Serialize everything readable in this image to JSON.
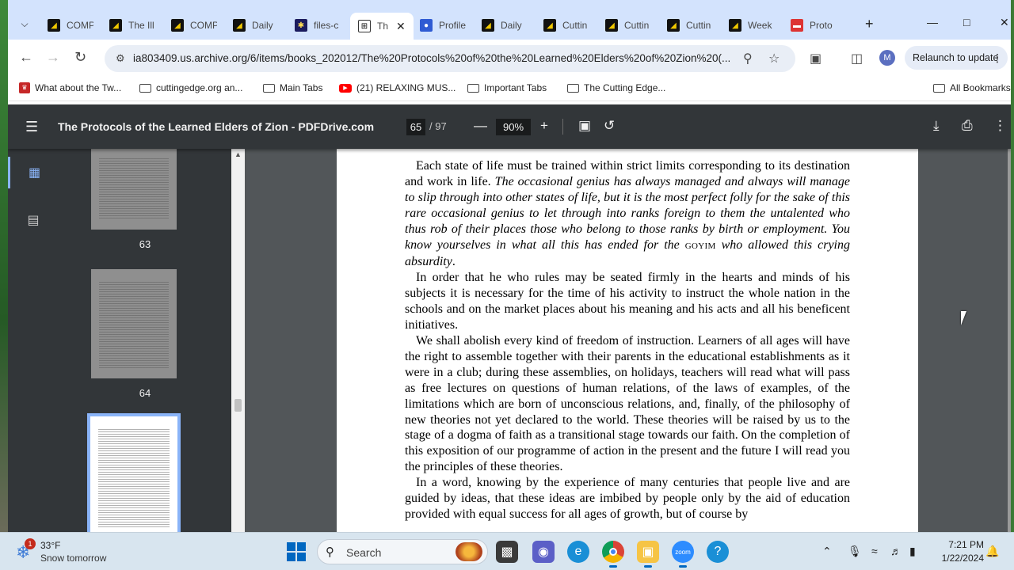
{
  "browser": {
    "tabs": [
      {
        "label": "COMP",
        "favicon": "cutting-edge"
      },
      {
        "label": "The Ill",
        "favicon": "cutting-edge"
      },
      {
        "label": "COMP",
        "favicon": "cutting-edge"
      },
      {
        "label": "Daily",
        "favicon": "cutting-edge"
      },
      {
        "label": "files-c",
        "favicon": "star"
      },
      {
        "label": "Th",
        "favicon": "internet-archive",
        "active": true
      },
      {
        "label": "Profile",
        "favicon": "profile"
      },
      {
        "label": "Daily",
        "favicon": "cutting-edge"
      },
      {
        "label": "Cuttin",
        "favicon": "cutting-edge"
      },
      {
        "label": "Cuttin",
        "favicon": "cutting-edge"
      },
      {
        "label": "Cuttin",
        "favicon": "cutting-edge"
      },
      {
        "label": "Week",
        "favicon": "cutting-edge"
      },
      {
        "label": "Proto",
        "favicon": "protocols"
      }
    ],
    "url": "ia803409.us.archive.org/6/items/books_202012/The%20Protocols%20of%20the%20Learned%20Elders%20of%20Zion%20(...",
    "profile_initial": "M",
    "relaunch_label": "Relaunch to update",
    "bookmarks": [
      {
        "label": "What about the Tw...",
        "icon": "site-icon"
      },
      {
        "label": "cuttingedge.org an...",
        "icon": "folder-icon"
      },
      {
        "label": "Main Tabs",
        "icon": "folder-icon"
      },
      {
        "label": "(21) RELAXING MUS...",
        "icon": "youtube-icon"
      },
      {
        "label": "Important Tabs",
        "icon": "folder-icon"
      },
      {
        "label": "The Cutting Edge...",
        "icon": "folder-icon"
      }
    ],
    "all_bookmarks_label": "All Bookmarks"
  },
  "pdf": {
    "title": "The Protocols of the Learned Elders of Zion - PDFDrive.com",
    "current_page": "65",
    "total_pages": "/ 97",
    "zoom": "90%",
    "thumbnails": [
      {
        "number": "63"
      },
      {
        "number": "64"
      },
      {
        "number": ""
      }
    ],
    "paragraphs": [
      {
        "parts": [
          {
            "text": "Each state of life must be trained within strict limits corresponding to its destination and work in life. ",
            "style": "normal"
          },
          {
            "text": "The occasional genius has always managed and always will manage to slip through into other states of life, but it is the most perfect folly for the sake of this rare occasional genius to let through into ranks foreign to them the untalented who thus rob of their places those who belong to those ranks by birth or employment. You know yourselves in what all this has ended for the ",
            "style": "italic"
          },
          {
            "text": "GOYIM",
            "style": "smallcaps"
          },
          {
            "text": " who allowed this crying absurdity",
            "style": "italic"
          },
          {
            "text": ".",
            "style": "normal"
          }
        ]
      },
      {
        "parts": [
          {
            "text": "In order that he who rules may be seated firmly in the hearts and minds of his subjects it is necessary for the time of his activity to instruct the whole nation in the schools and on the market places about his meaning and his acts and all his beneficent initiatives.",
            "style": "normal"
          }
        ]
      },
      {
        "parts": [
          {
            "text": "We shall abolish every kind of freedom of instruction. Learners of all ages will have the right to assemble together with their parents in the educational establishments as it were in a club; during these assemblies, on holidays, teachers will read what will pass as free lectures on questions of human relations, of the laws of examples, of the limitations which are born of unconscious relations, and, finally, of the philosophy of new theories not yet declared to the world. These theories will be raised by us to the stage of a dogma of faith as a transitional stage towards our faith. On the completion of this exposition of our programme of action in the present and the future I will read you the principles of these theories.",
            "style": "normal"
          }
        ]
      },
      {
        "parts": [
          {
            "text": "In a word, knowing by the experience of many centuries that people live and are guided by ideas, that these ideas are imbibed by people only by the aid of education provided with equal success for all ages of growth, but of course by",
            "style": "normal"
          }
        ]
      }
    ]
  },
  "taskbar": {
    "weather_badge": "1",
    "weather_temp": "33°F",
    "weather_desc": "Snow tomorrow",
    "search_label": "Search",
    "apps": [
      "file-icon",
      "meet-icon",
      "edge-icon",
      "chrome-icon",
      "explorer-icon",
      "zoom-icon",
      "help-icon"
    ],
    "time": "7:21 PM",
    "date": "1/22/2024"
  },
  "colors": {
    "tabstrip": "#d3e3fd",
    "pdf_toolbar": "#323639",
    "viewer_bg": "#525659",
    "accent": "#8ab4f8",
    "taskbar": "#d8e5ef"
  }
}
